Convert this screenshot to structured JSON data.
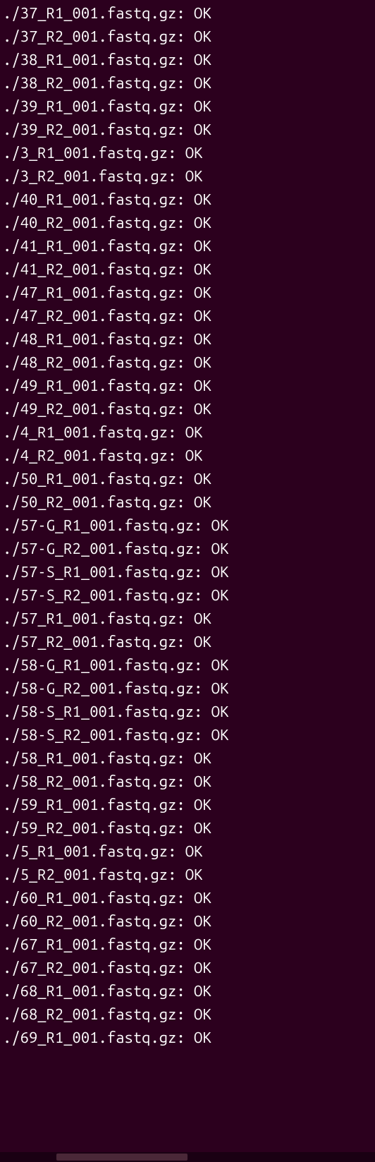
{
  "lines": [
    "./37_R1_001.fastq.gz: OK",
    "./37_R2_001.fastq.gz: OK",
    "./38_R1_001.fastq.gz: OK",
    "./38_R2_001.fastq.gz: OK",
    "./39_R1_001.fastq.gz: OK",
    "./39_R2_001.fastq.gz: OK",
    "./3_R1_001.fastq.gz: OK",
    "./3_R2_001.fastq.gz: OK",
    "./40_R1_001.fastq.gz: OK",
    "./40_R2_001.fastq.gz: OK",
    "./41_R1_001.fastq.gz: OK",
    "./41_R2_001.fastq.gz: OK",
    "./47_R1_001.fastq.gz: OK",
    "./47_R2_001.fastq.gz: OK",
    "./48_R1_001.fastq.gz: OK",
    "./48_R2_001.fastq.gz: OK",
    "./49_R1_001.fastq.gz: OK",
    "./49_R2_001.fastq.gz: OK",
    "./4_R1_001.fastq.gz: OK",
    "./4_R2_001.fastq.gz: OK",
    "./50_R1_001.fastq.gz: OK",
    "./50_R2_001.fastq.gz: OK",
    "./57-G_R1_001.fastq.gz: OK",
    "./57-G_R2_001.fastq.gz: OK",
    "./57-S_R1_001.fastq.gz: OK",
    "./57-S_R2_001.fastq.gz: OK",
    "./57_R1_001.fastq.gz: OK",
    "./57_R2_001.fastq.gz: OK",
    "./58-G_R1_001.fastq.gz: OK",
    "./58-G_R2_001.fastq.gz: OK",
    "./58-S_R1_001.fastq.gz: OK",
    "./58-S_R2_001.fastq.gz: OK",
    "./58_R1_001.fastq.gz: OK",
    "./58_R2_001.fastq.gz: OK",
    "./59_R1_001.fastq.gz: OK",
    "./59_R2_001.fastq.gz: OK",
    "./5_R1_001.fastq.gz: OK",
    "./5_R2_001.fastq.gz: OK",
    "./60_R1_001.fastq.gz: OK",
    "./60_R2_001.fastq.gz: OK",
    "./67_R1_001.fastq.gz: OK",
    "./67_R2_001.fastq.gz: OK",
    "./68_R1_001.fastq.gz: OK",
    "./68_R2_001.fastq.gz: OK",
    "./69_R1_001.fastq.gz: OK"
  ]
}
